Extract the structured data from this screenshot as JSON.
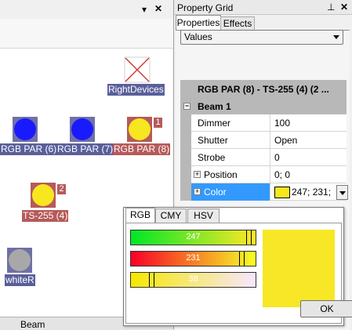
{
  "left_pane": {
    "pin_icon": "▾",
    "close_icon": "✕",
    "bottom_tab_label": "Beam",
    "devices": [
      {
        "label": "RightDevices",
        "label_color": "blue",
        "kind": "missing",
        "color": "#ffffff"
      },
      {
        "label": "RGB PAR (6)",
        "label_color": "blue",
        "kind": "square",
        "color": "#1a1aff"
      },
      {
        "label": "RGB PAR (7)",
        "label_color": "blue",
        "kind": "square",
        "color": "#1a1aff"
      },
      {
        "label": "RGB PAR (8)",
        "label_color": "red",
        "kind": "square",
        "color": "#f7e71f",
        "badge": "1"
      },
      {
        "label": "TS-255 (4)",
        "label_color": "red",
        "kind": "square",
        "color": "#f7e71f",
        "badge": "2"
      },
      {
        "label": "whiteR",
        "label_color": "blue",
        "kind": "square",
        "color": "#a8a8a8"
      }
    ]
  },
  "property_grid": {
    "title": "Property Grid",
    "pin_icon": "⊥",
    "close_icon": "✕",
    "tabs": {
      "properties": "Properties",
      "effects": "Effects"
    },
    "values_dropdown": "Values",
    "header": "RGB PAR (8) - TS-255 (4) (2 ...",
    "category": "Beam 1",
    "rows": [
      {
        "name": "Dimmer",
        "value": "100"
      },
      {
        "name": "Shutter",
        "value": "Open"
      },
      {
        "name": "Strobe",
        "value": "0"
      },
      {
        "name": "Position",
        "value": "0; 0",
        "expandable": true
      },
      {
        "name": "Color",
        "value": "247; 231;",
        "expandable": true,
        "selected": true
      }
    ],
    "color_swatch": "#f7e71f"
  },
  "color_editor": {
    "tabs": [
      "RGB",
      "CMY",
      "HSV"
    ],
    "active_tab": "RGB",
    "r": 247,
    "g": 231,
    "b": 38,
    "r_label": "247",
    "g_label": "231",
    "b_label": "38",
    "preview_color": "#f7e726",
    "ok_label": "OK"
  }
}
